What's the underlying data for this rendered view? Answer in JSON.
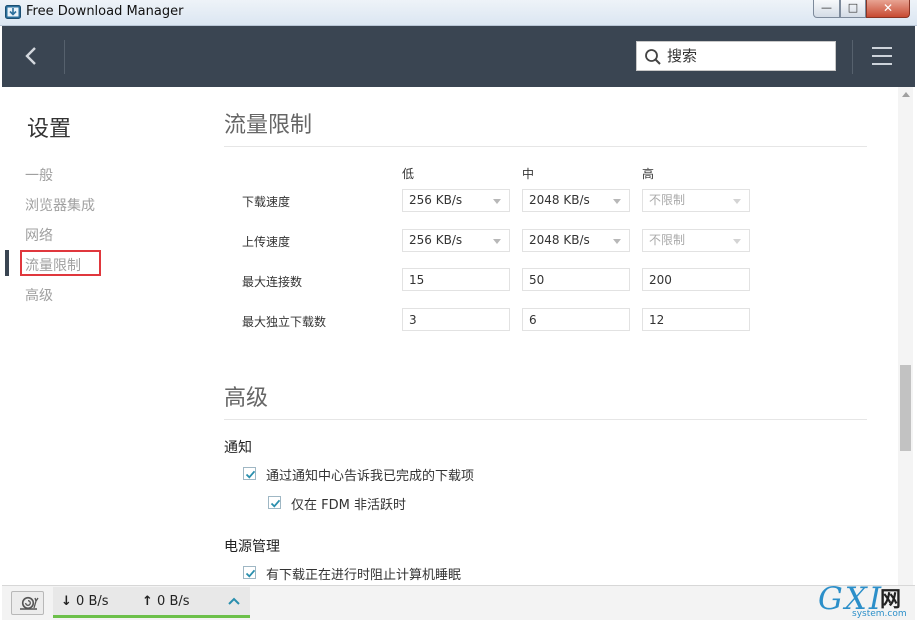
{
  "window": {
    "title": "Free Download Manager",
    "controls": {
      "minimize": "—",
      "maximize": "□",
      "close": "✕"
    }
  },
  "toolbar": {
    "back_icon": "chevron-left-icon",
    "search": {
      "placeholder": "搜索",
      "value": "",
      "icon": "search-icon"
    },
    "menu_icon": "hamburger-menu-icon"
  },
  "sidebar": {
    "title": "设置",
    "items": [
      {
        "label": "一般",
        "active": false
      },
      {
        "label": "浏览器集成",
        "active": false
      },
      {
        "label": "网络",
        "active": false
      },
      {
        "label": "流量限制",
        "active": true
      },
      {
        "label": "高级",
        "active": false
      }
    ]
  },
  "traffic_limits": {
    "title": "流量限制",
    "columns": [
      "低",
      "中",
      "高"
    ],
    "rows": [
      {
        "label": "下载速度",
        "kind": "combo",
        "values": [
          "256 KB/s",
          "2048 KB/s",
          "不限制"
        ],
        "disabled": [
          false,
          false,
          true
        ]
      },
      {
        "label": "上传速度",
        "kind": "combo",
        "values": [
          "256 KB/s",
          "2048 KB/s",
          "不限制"
        ],
        "disabled": [
          false,
          false,
          true
        ]
      },
      {
        "label": "最大连接数",
        "kind": "field",
        "values": [
          "15",
          "50",
          "200"
        ]
      },
      {
        "label": "最大独立下载数",
        "kind": "field",
        "values": [
          "3",
          "6",
          "12"
        ]
      }
    ]
  },
  "advanced": {
    "title": "高级",
    "notifications": {
      "title": "通知",
      "options": [
        {
          "label": "通过通知中心告诉我已完成的下载项",
          "checked": true
        },
        {
          "label": "仅在 FDM 非活跃时",
          "checked": true
        }
      ]
    },
    "power": {
      "title": "电源管理",
      "options": [
        {
          "label": "有下载正在进行时阻止计算机睡眠",
          "checked": true
        }
      ]
    }
  },
  "statusbar": {
    "snail_icon": "snail-icon",
    "download_arrow": "↓",
    "download_speed": "0 B/s",
    "upload_arrow": "↑",
    "upload_speed": "0 B/s",
    "expand_icon": "chevron-up-icon"
  },
  "watermark": {
    "brand": "GXI",
    "suffix": "网",
    "site": "system.com"
  },
  "colors": {
    "toolbar_bg": "#3a4552",
    "accent_green": "#6cc04a",
    "highlight_red": "#e0373d",
    "check_teal": "#2a8fae"
  }
}
